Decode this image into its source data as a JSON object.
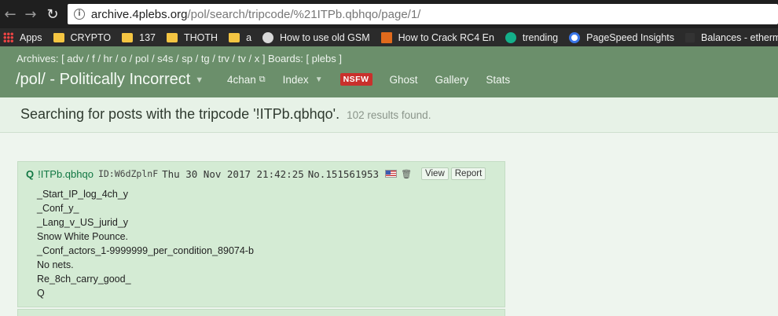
{
  "browser": {
    "url_host": "archive.4plebs.org",
    "url_path": "/pol/search/tripcode/%21ITPb.qbhqo/page/1/",
    "bookmarks": [
      {
        "label": "Apps",
        "icon": "apps-grid-icon"
      },
      {
        "label": "CRYPTO",
        "icon": "folder-icon"
      },
      {
        "label": "137",
        "icon": "folder-icon"
      },
      {
        "label": "THOTH",
        "icon": "folder-icon"
      },
      {
        "label": "a",
        "icon": "folder-icon"
      },
      {
        "label": "How to use old GSM",
        "icon": "site-favicon"
      },
      {
        "label": "How to Crack RC4 En",
        "icon": "site-favicon"
      },
      {
        "label": "trending",
        "icon": "site-favicon"
      },
      {
        "label": "PageSpeed Insights",
        "icon": "site-favicon"
      },
      {
        "label": "Balances - ethermine",
        "icon": "site-favicon"
      }
    ]
  },
  "header": {
    "archives_line": "Archives: [ adv / f / hr / o / pol / s4s / sp / tg / trv / tv / x ] Boards: [ plebs ]",
    "board_title": "/pol/ - Politically Incorrect",
    "nav": {
      "fourchan": "4chan",
      "index": "Index",
      "nsfw": "NSFW",
      "ghost": "Ghost",
      "gallery": "Gallery",
      "stats": "Stats"
    }
  },
  "search": {
    "text": "Searching for posts with the tripcode '!ITPb.qbhqo'.",
    "count": "102 results found."
  },
  "post": {
    "name": "Q",
    "tripcode": "!ITPb.qbhqo",
    "id": "ID:W6dZplnF",
    "date": "Thu 30 Nov 2017 21:42:25",
    "number": "No.151561953",
    "view_label": "View",
    "report_label": "Report",
    "lines": [
      "_Start_IP_log_4ch_y",
      "_Conf_y_",
      "_Lang_v_US_jurid_y",
      "Snow White Pounce.",
      "_Conf_actors_1-9999999_per_condition_89074-b",
      "No nets.",
      "Re_8ch_carry_good_",
      "Q"
    ]
  },
  "colors": {
    "header_bg": "#6b8f6b",
    "post_bg": "#d4ebd4",
    "name_green": "#117743",
    "nsfw_red": "#c9302c"
  }
}
